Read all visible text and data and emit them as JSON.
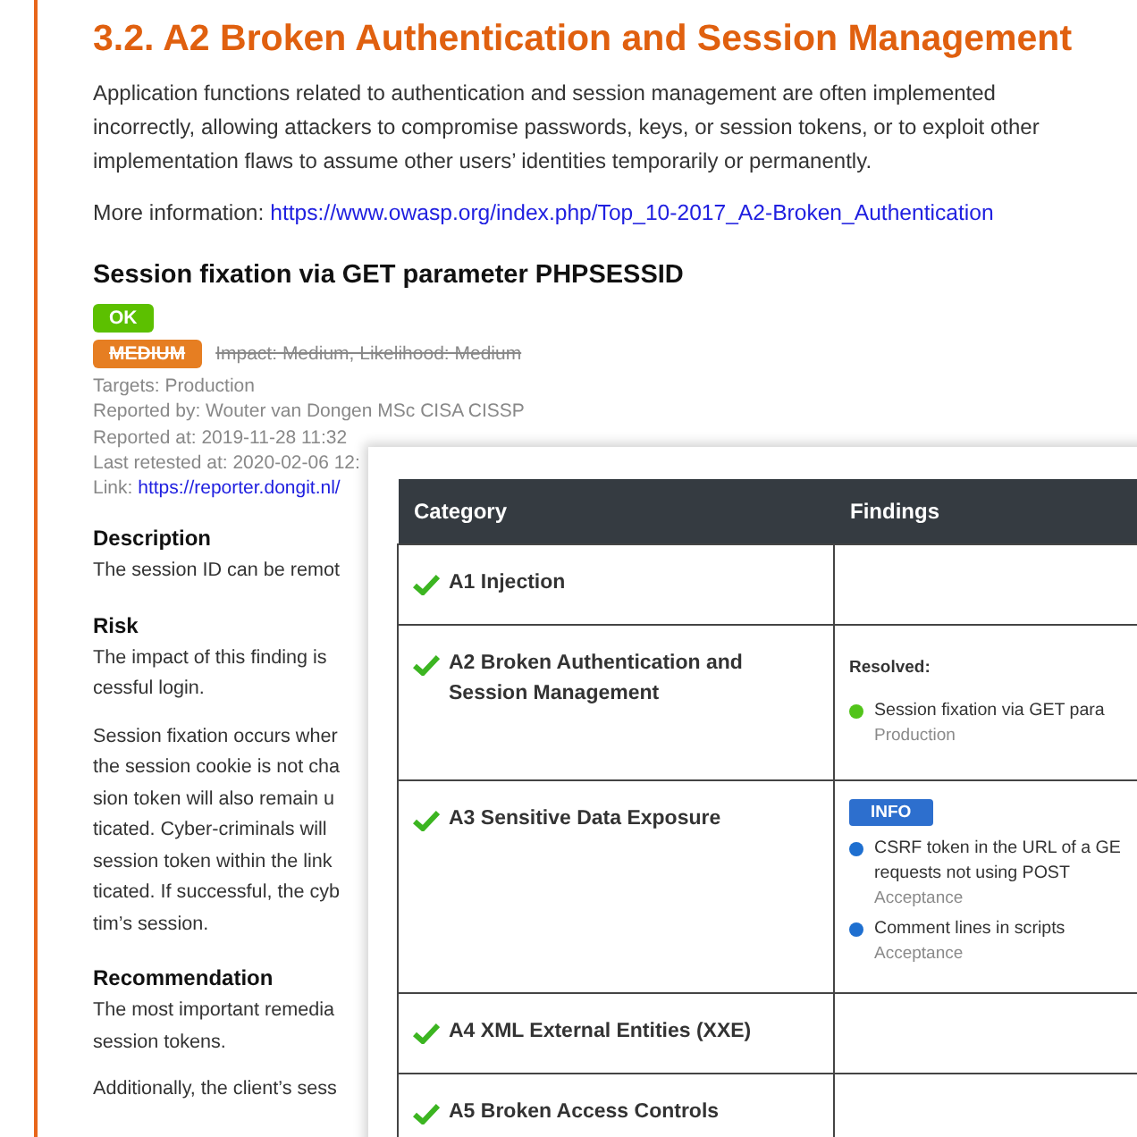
{
  "section": {
    "title": "3.2. A2 Broken Authentication and Session Management",
    "intro": "Application functions related to authentication and session management are often implemented incorrectly, allowing attackers to compromise passwords, keys, or session tokens, or to exploit other implementation flaws to assume other users’ identities temporarily or permanently.",
    "more_label": "More information:",
    "more_link": "https://www.owasp.org/index.php/Top_10-2017_A2-Broken_Authentication"
  },
  "finding": {
    "title": "Session fixation via GET parameter PHPSESSID",
    "status": "OK",
    "severity": "MEDIUM",
    "severity_struck": true,
    "impact": "Impact: Medium, Likelihood: Medium",
    "meta": [
      "Targets: Production",
      "Reported by: Wouter van Dongen MSc CISA CISSP",
      "Reported at: 2019-11-28 11:32",
      "Last retested at: 2020-02-06 12:"
    ],
    "link_label": "Link:",
    "link": "https://reporter.dongit.nl/",
    "sections": [
      {
        "heading": "Description",
        "paragraphs": [
          [
            "The session ID can be remot"
          ]
        ]
      },
      {
        "heading": "Risk",
        "paragraphs": [
          [
            "The impact of this finding is",
            "cessful login."
          ],
          [
            "Session fixation occurs wher",
            "the session cookie is not cha",
            "sion token will also remain u",
            "ticated. Cyber-criminals will",
            "session token within the link",
            "ticated. If successful, the cyb",
            "tim’s session."
          ]
        ]
      },
      {
        "heading": "Recommendation",
        "paragraphs": [
          [
            "The most important remedia",
            "session tokens."
          ],
          [
            "Additionally, the client’s sess"
          ]
        ]
      }
    ]
  },
  "table": {
    "columns": [
      "Category",
      "Findings"
    ],
    "rows": [
      {
        "category": "A1 Injection",
        "passed": true,
        "findings": []
      },
      {
        "category": "A2 Broken Authentication and Session Management",
        "passed": true,
        "label": "Resolved:",
        "findings": [
          {
            "title": "Session fixation via GET para",
            "target": "Production",
            "color": "#52c41a"
          }
        ]
      },
      {
        "category": "A3 Sensitive Data Exposure",
        "passed": true,
        "badge": "INFO",
        "findings": [
          {
            "title": "CSRF token in the URL of a GE\nrequests not using POST",
            "target": "Acceptance",
            "color": "#1e6fd0"
          },
          {
            "title": "Comment lines in scripts",
            "target": "Acceptance",
            "color": "#1e6fd0"
          }
        ]
      },
      {
        "category": "A4 XML External Entities (XXE)",
        "passed": true,
        "findings": []
      },
      {
        "category": "A5 Broken Access Controls",
        "passed": true,
        "findings": []
      }
    ]
  }
}
